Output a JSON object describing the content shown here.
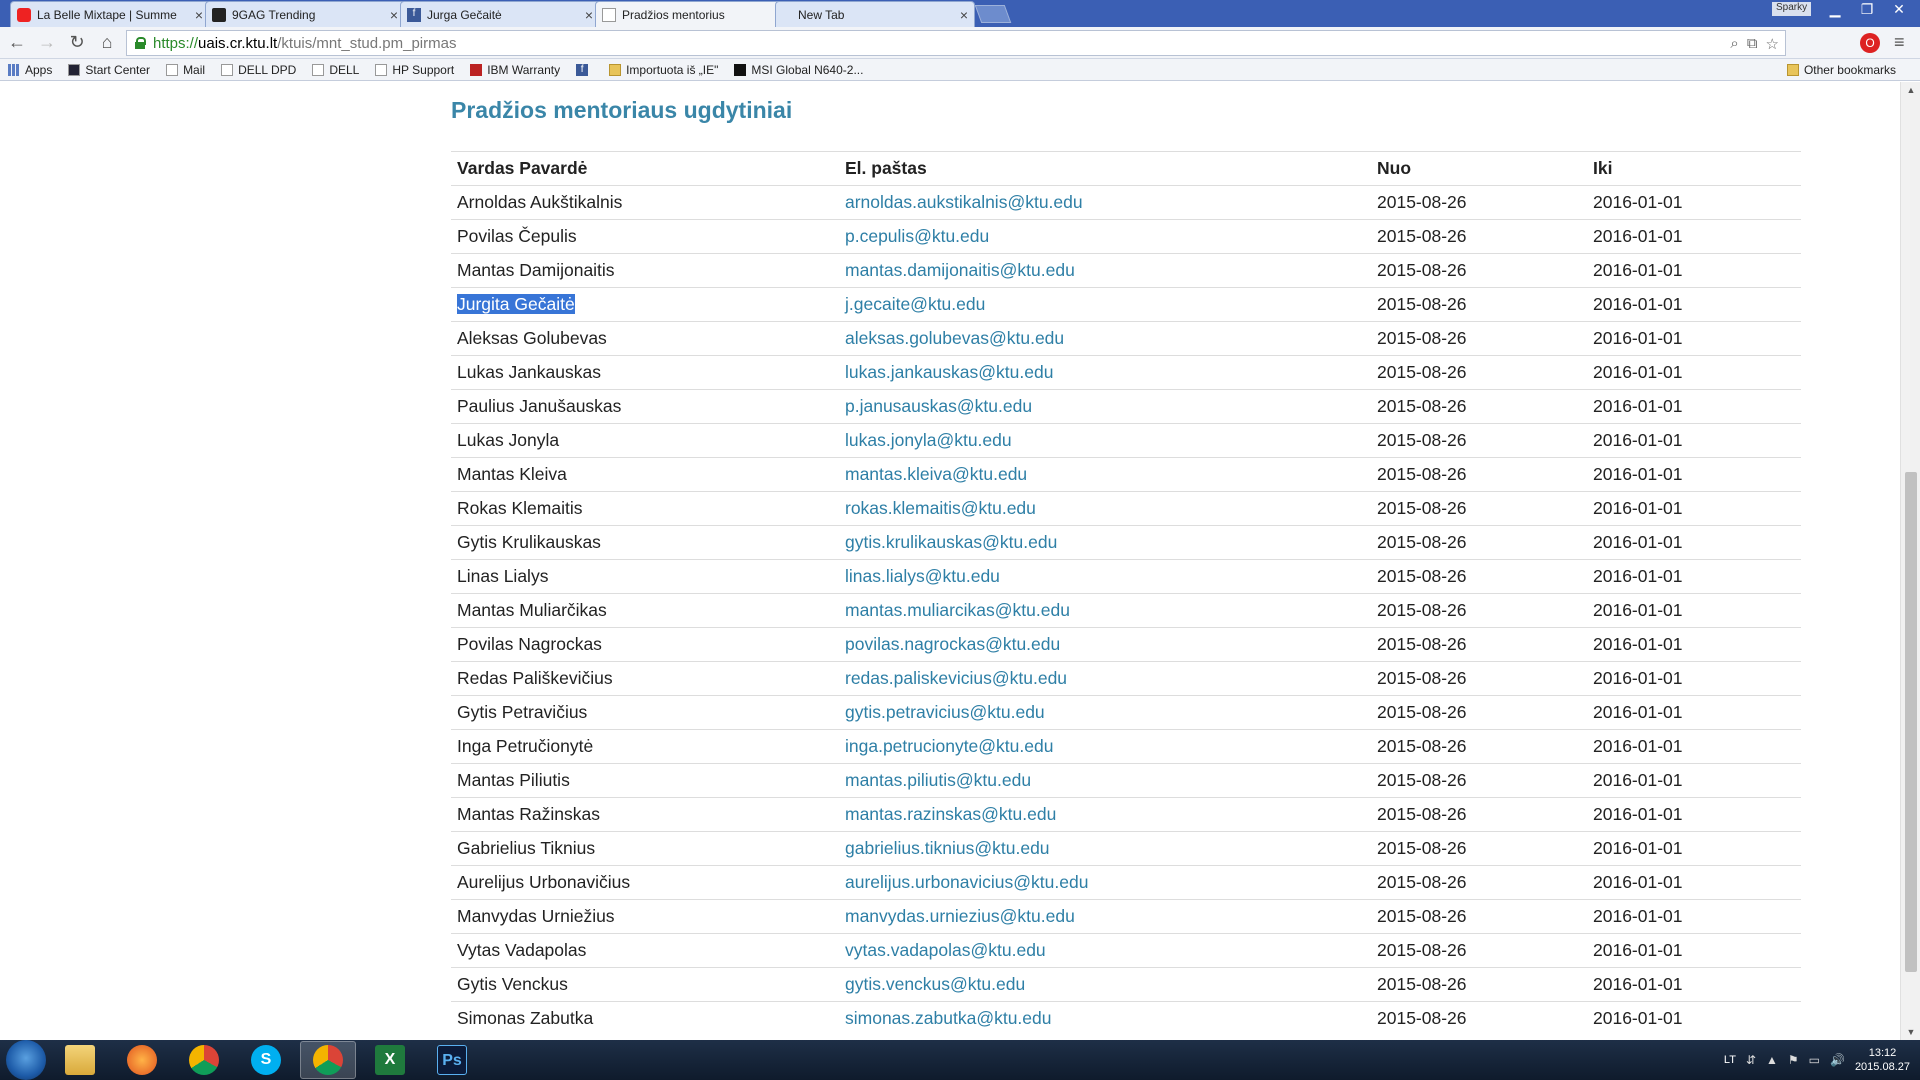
{
  "browser": {
    "tabs": [
      {
        "title": "La Belle Mixtape | Summe",
        "favicon": "youtube-icon",
        "active": false
      },
      {
        "title": "9GAG Trending",
        "favicon": "9gag-icon",
        "active": false
      },
      {
        "title": "Jurga Gečaitė",
        "favicon": "facebook-icon",
        "active": false
      },
      {
        "title": "Pradžios mentorius",
        "favicon": "page-icon",
        "active": true
      },
      {
        "title": "New Tab",
        "favicon": "",
        "active": false
      }
    ],
    "user": "Sparky",
    "url": {
      "scheme": "https://",
      "host": "uais.cr.ktu.lt",
      "path": "/ktuis/mnt_stud.pm_pirmas"
    },
    "bookmarks": [
      {
        "label": "Apps",
        "icon": "apps-icon"
      },
      {
        "label": "Start Center",
        "icon": "page-icon"
      },
      {
        "label": "Mail",
        "icon": "page-icon"
      },
      {
        "label": "DELL DPD",
        "icon": "page-icon"
      },
      {
        "label": "DELL",
        "icon": "page-icon"
      },
      {
        "label": "HP Support",
        "icon": "page-icon"
      },
      {
        "label": "IBM Warranty",
        "icon": "ibm-icon"
      },
      {
        "label": "",
        "icon": "facebook-icon"
      },
      {
        "label": "Importuota iš „IE\"",
        "icon": "folder-icon"
      },
      {
        "label": "MSI Global N640-2...",
        "icon": "msi-icon"
      }
    ],
    "other_bookmarks": "Other bookmarks"
  },
  "page": {
    "title": "Pradžios mentoriaus ugdytiniai",
    "columns": {
      "name": "Vardas Pavardė",
      "email": "El. paštas",
      "from": "Nuo",
      "to": "Iki"
    },
    "rows": [
      {
        "name": "Arnoldas Aukštikalnis",
        "email": "arnoldas.aukstikalnis@ktu.edu",
        "from": "2015-08-26",
        "to": "2016-01-01"
      },
      {
        "name": "Povilas Čepulis",
        "email": "p.cepulis@ktu.edu",
        "from": "2015-08-26",
        "to": "2016-01-01"
      },
      {
        "name": "Mantas Damijonaitis",
        "email": "mantas.damijonaitis@ktu.edu",
        "from": "2015-08-26",
        "to": "2016-01-01"
      },
      {
        "name": "Jurgita Gečaitė",
        "email": "j.gecaite@ktu.edu",
        "from": "2015-08-26",
        "to": "2016-01-01",
        "selected": true
      },
      {
        "name": "Aleksas Golubevas",
        "email": "aleksas.golubevas@ktu.edu",
        "from": "2015-08-26",
        "to": "2016-01-01"
      },
      {
        "name": "Lukas Jankauskas",
        "email": "lukas.jankauskas@ktu.edu",
        "from": "2015-08-26",
        "to": "2016-01-01"
      },
      {
        "name": "Paulius Janušauskas",
        "email": "p.janusauskas@ktu.edu",
        "from": "2015-08-26",
        "to": "2016-01-01"
      },
      {
        "name": "Lukas Jonyla",
        "email": "lukas.jonyla@ktu.edu",
        "from": "2015-08-26",
        "to": "2016-01-01"
      },
      {
        "name": "Mantas Kleiva",
        "email": "mantas.kleiva@ktu.edu",
        "from": "2015-08-26",
        "to": "2016-01-01"
      },
      {
        "name": "Rokas Klemaitis",
        "email": "rokas.klemaitis@ktu.edu",
        "from": "2015-08-26",
        "to": "2016-01-01"
      },
      {
        "name": "Gytis Krulikauskas",
        "email": "gytis.krulikauskas@ktu.edu",
        "from": "2015-08-26",
        "to": "2016-01-01"
      },
      {
        "name": "Linas Lialys",
        "email": "linas.lialys@ktu.edu",
        "from": "2015-08-26",
        "to": "2016-01-01"
      },
      {
        "name": "Mantas Muliarčikas",
        "email": "mantas.muliarcikas@ktu.edu",
        "from": "2015-08-26",
        "to": "2016-01-01"
      },
      {
        "name": "Povilas Nagrockas",
        "email": "povilas.nagrockas@ktu.edu",
        "from": "2015-08-26",
        "to": "2016-01-01"
      },
      {
        "name": "Redas Pališkevičius",
        "email": "redas.paliskevicius@ktu.edu",
        "from": "2015-08-26",
        "to": "2016-01-01"
      },
      {
        "name": "Gytis Petravičius",
        "email": "gytis.petravicius@ktu.edu",
        "from": "2015-08-26",
        "to": "2016-01-01"
      },
      {
        "name": "Inga Petručionytė",
        "email": "inga.petrucionyte@ktu.edu",
        "from": "2015-08-26",
        "to": "2016-01-01"
      },
      {
        "name": "Mantas Piliutis",
        "email": "mantas.piliutis@ktu.edu",
        "from": "2015-08-26",
        "to": "2016-01-01"
      },
      {
        "name": "Mantas Ražinskas",
        "email": "mantas.razinskas@ktu.edu",
        "from": "2015-08-26",
        "to": "2016-01-01"
      },
      {
        "name": "Gabrielius Tiknius",
        "email": "gabrielius.tiknius@ktu.edu",
        "from": "2015-08-26",
        "to": "2016-01-01"
      },
      {
        "name": "Aurelijus Urbonavičius",
        "email": "aurelijus.urbonavicius@ktu.edu",
        "from": "2015-08-26",
        "to": "2016-01-01"
      },
      {
        "name": "Manvydas Urniežius",
        "email": "manvydas.urniezius@ktu.edu",
        "from": "2015-08-26",
        "to": "2016-01-01"
      },
      {
        "name": "Vytas Vadapolas",
        "email": "vytas.vadapolas@ktu.edu",
        "from": "2015-08-26",
        "to": "2016-01-01"
      },
      {
        "name": "Gytis Venckus",
        "email": "gytis.venckus@ktu.edu",
        "from": "2015-08-26",
        "to": "2016-01-01"
      },
      {
        "name": "Simonas Zabutka",
        "email": "simonas.zabutka@ktu.edu",
        "from": "2015-08-26",
        "to": "2016-01-01"
      }
    ]
  },
  "taskbar": {
    "apps": [
      {
        "name": "explorer-icon",
        "active": false
      },
      {
        "name": "firefox-icon",
        "active": false
      },
      {
        "name": "chrome-icon",
        "active": false
      },
      {
        "name": "skype-icon",
        "label": "S",
        "active": false
      },
      {
        "name": "chrome-icon",
        "active": true
      },
      {
        "name": "excel-icon",
        "label": "X",
        "active": false
      },
      {
        "name": "photoshop-icon",
        "label": "Ps",
        "active": false
      }
    ],
    "language": "LT",
    "time": "13:12",
    "date": "2015.08.27"
  },
  "colors": {
    "title": "#3a86a8",
    "link": "#2e7fa6",
    "selection": "#3875d7"
  }
}
